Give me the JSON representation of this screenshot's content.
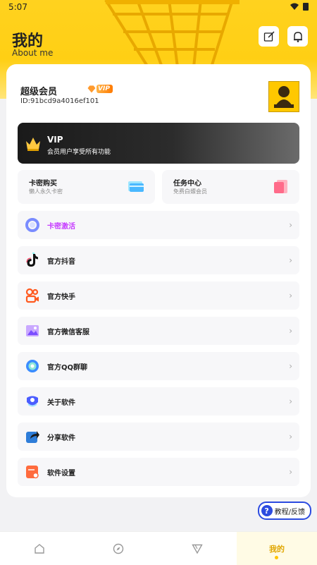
{
  "status": {
    "time": "5:07"
  },
  "header": {
    "title": "我的",
    "subtitle": "About me"
  },
  "profile": {
    "member_name": "超级会员",
    "vip_tag": "VIP",
    "id_text": "ID:91bcd9a4016ef101"
  },
  "vip_card": {
    "title": "VIP",
    "desc": "会员用户享受所有功能"
  },
  "quick_cards": [
    {
      "title": "卡密购买",
      "desc": "懒人永久卡密"
    },
    {
      "title": "任务中心",
      "desc": "免费白嫖会员"
    }
  ],
  "menu": [
    {
      "label": "卡密激活",
      "icon": "ring-icon"
    },
    {
      "label": "官方抖音",
      "icon": "tiktok-icon"
    },
    {
      "label": "官方快手",
      "icon": "kuaishou-icon"
    },
    {
      "label": "官方微信客服",
      "icon": "image-icon"
    },
    {
      "label": "官方QQ群聊",
      "icon": "qq-icon"
    },
    {
      "label": "关于软件",
      "icon": "info-icon"
    },
    {
      "label": "分享软件",
      "icon": "share-icon"
    },
    {
      "label": "软件设置",
      "icon": "settings-icon"
    }
  ],
  "feedback": {
    "label": "教程/反馈",
    "icon_text": "?"
  },
  "bottom_nav": {
    "active_label": "我的"
  },
  "colors": {
    "accent": "#ffcf14",
    "vip_purple": "#c63cff",
    "feedback_blue": "#2c4be0"
  }
}
